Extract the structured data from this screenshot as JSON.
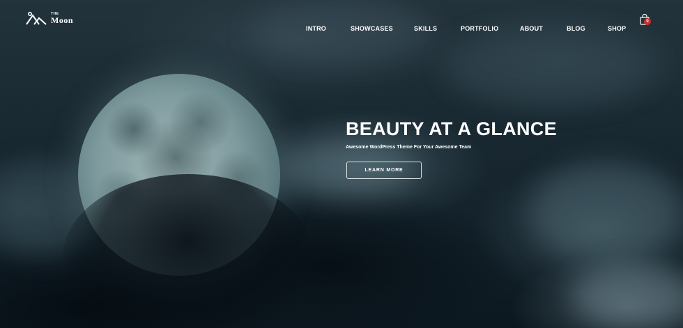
{
  "brand": {
    "small": "THE",
    "name": "Moon",
    "mark_icon": "mountain-logo-icon"
  },
  "nav": {
    "items": [
      {
        "label": "INTRO"
      },
      {
        "label": "SHOWCASES"
      },
      {
        "label": "SKILLS"
      },
      {
        "label": "PORTFOLIO"
      },
      {
        "label": "ABOUT"
      },
      {
        "label": "BLOG"
      },
      {
        "label": "SHOP"
      }
    ]
  },
  "cart": {
    "icon": "shopping-bag-icon",
    "count": "0",
    "badge_color": "#d02a2a"
  },
  "hero": {
    "headline": "BEAUTY AT A GLANCE",
    "subline": "Awesome WordPress Theme For Your Awesome Team",
    "cta_label": "LEARN MORE"
  }
}
